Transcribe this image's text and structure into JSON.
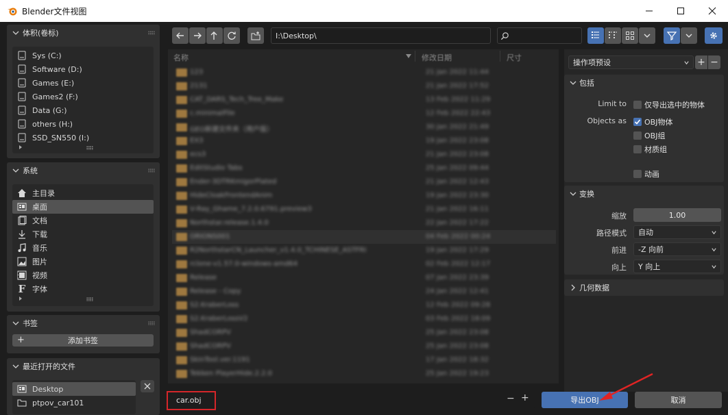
{
  "window": {
    "title": "Blender文件视图"
  },
  "sidebar": {
    "volumes": {
      "title": "体积(卷标)",
      "items": [
        {
          "label": "Sys (C:)"
        },
        {
          "label": "Software (D:)"
        },
        {
          "label": "Games (E:)"
        },
        {
          "label": "Games2 (F:)"
        },
        {
          "label": "Data (G:)"
        },
        {
          "label": "others (H:)"
        },
        {
          "label": "SSD_SN550 (I:)"
        }
      ]
    },
    "system": {
      "title": "系统",
      "items": [
        {
          "label": "主目录",
          "icon": "home-icon"
        },
        {
          "label": "桌面",
          "icon": "desktop-icon",
          "active": true
        },
        {
          "label": "文档",
          "icon": "documents-icon"
        },
        {
          "label": "下载",
          "icon": "download-icon"
        },
        {
          "label": "音乐",
          "icon": "music-icon"
        },
        {
          "label": "图片",
          "icon": "image-icon"
        },
        {
          "label": "视频",
          "icon": "video-icon"
        },
        {
          "label": "字体",
          "icon": "font-icon"
        }
      ]
    },
    "bookmarks": {
      "title": "书签",
      "add_label": "添加书签"
    },
    "recent": {
      "title": "最近打开的文件",
      "items": [
        {
          "label": "Desktop",
          "active": true
        },
        {
          "label": "ptpov_car101"
        }
      ]
    }
  },
  "toolbar": {
    "path": "I:\\Desktop\\",
    "search_placeholder": ""
  },
  "filelist": {
    "columns": {
      "name": "名称",
      "date": "修改日期",
      "size": "尺寸"
    },
    "rows": [
      {
        "name": "123",
        "date": "21 Jan 2022 11:44"
      },
      {
        "name": "2131",
        "date": "21 Jan 2022 17:52"
      },
      {
        "name": "CAT_DARS_Tech_Tree_Make",
        "date": "13 Feb 2022 11:29"
      },
      {
        "name": "c.minimalFile",
        "date": "12 Feb 2022 22:43"
      },
      {
        "name": "GEO新建文件夹（用户版）",
        "date": "30 Jan 2022 21:49"
      },
      {
        "name": "EX3",
        "date": "19 Jan 2022 23:08"
      },
      {
        "name": "ecs3",
        "date": "21 Jan 2022 23:08"
      },
      {
        "name": "EditStudio Tabs",
        "date": "25 Jan 2022 09:44"
      },
      {
        "name": "Ender-3DTRKmigorPlated",
        "date": "21 Jan 2022 12:43"
      },
      {
        "name": "HideCloakFrontendAnim",
        "date": "19 Jan 2022 23:30"
      },
      {
        "name": "V-Ray_Ghame_7.2.0.6791.preview3",
        "date": "21 Jan 2022 16:11"
      },
      {
        "name": "Northstar.release.1.4.0",
        "date": "22 Jan 2022 17:22"
      },
      {
        "name": "ORIONS001",
        "date": "04 Feb 2022 00:24"
      },
      {
        "name": "R2NorthstarCN_Launcher_v1.4.0_TCHINESE_ASTFRI",
        "date": "19 Jan 2022 17:29"
      },
      {
        "name": "rclone-v1.57.0-windows-amd64",
        "date": "02 Feb 2022 12:17"
      },
      {
        "name": "Release",
        "date": "07 Jan 2022 23:39"
      },
      {
        "name": "Release - Copy",
        "date": "24 Jan 2022 12:41"
      },
      {
        "name": "S2.KraberLoss",
        "date": "12 Feb 2022 09:28"
      },
      {
        "name": "S2.KraberLossV2",
        "date": "03 Feb 2022 18:09"
      },
      {
        "name": "ShadCORPV",
        "date": "25 Jan 2022 23:08"
      },
      {
        "name": "ShadCORPV",
        "date": "25 Jan 2022 23:08"
      },
      {
        "name": "SkinTool.ver.1191",
        "date": "17 Jan 2022 18:32"
      },
      {
        "name": "Tekken PlayerHide.2.2.0",
        "date": "25 Jan 2022 19:23"
      }
    ]
  },
  "options": {
    "preset_label": "操作项预设",
    "include": {
      "title": "包括",
      "limit_to_label": "Limit to",
      "selected_only": "仅导出选中的物体",
      "objects_as_label": "Objects as",
      "obj_objects": "OBJ物体",
      "obj_groups": "OBJ组",
      "material_groups": "材质组",
      "animation": "动画"
    },
    "transform": {
      "title": "变换",
      "scale_label": "缩放",
      "scale_value": "1.00",
      "path_mode_label": "路径模式",
      "path_mode_value": "自动",
      "forward_label": "前进",
      "forward_value": "-Z 向前",
      "up_label": "向上",
      "up_value": "Y 向上"
    },
    "geometry": {
      "title": "几何数据"
    }
  },
  "bottom": {
    "filename": "car.obj",
    "export_label": "导出OBJ",
    "cancel_label": "取消"
  },
  "colors": {
    "accent": "#4772b3",
    "highlight_box": "#d6262a",
    "arrow": "#e02424"
  }
}
